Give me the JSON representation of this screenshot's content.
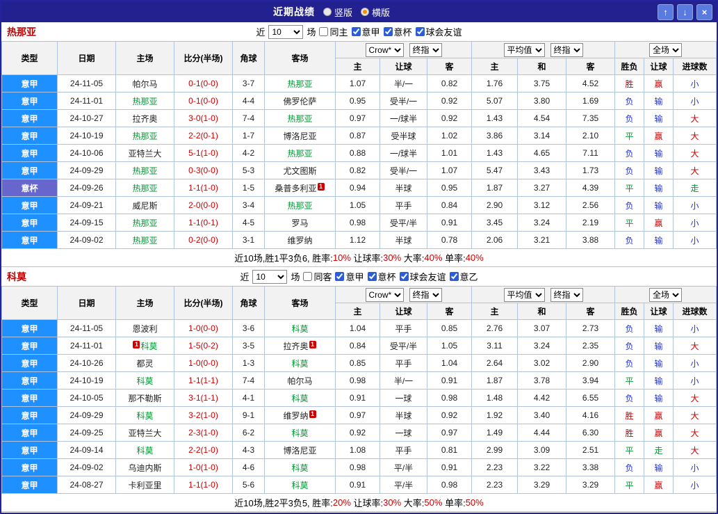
{
  "colors": {
    "win": "#cc0000",
    "draw": "#009933",
    "lose": "#2233cc",
    "score": "#cc0000",
    "self_team": "#009933",
    "badge_bg": "#d00000",
    "league_bg": "#1e90ff",
    "cup_bg": "#6666cc",
    "titlebar_bg": "#23218f",
    "grid_border": "#b0c4de"
  },
  "value_colors": {
    "胜": "win",
    "赢": "win",
    "大": "win",
    "平": "draw",
    "走": "draw",
    "负": "lose",
    "输": "lose",
    "小": "lose"
  },
  "type_bg_map": {
    "意甲": "league_bg",
    "意杯": "cup_bg"
  },
  "titlebar": {
    "title": "近期战绩",
    "layout_options": [
      {
        "label": "竖版",
        "selected": false
      },
      {
        "label": "横版",
        "selected": true
      }
    ],
    "buttons": {
      "up": "↑",
      "down": "↓",
      "close": "×"
    }
  },
  "table_header": {
    "type": "类型",
    "date": "日期",
    "home": "主场",
    "score": "比分(半场)",
    "corners": "角球",
    "away": "客场",
    "odds_group": {
      "select1": "Crow*",
      "select2": "终指",
      "cols": [
        "主",
        "让球",
        "客"
      ]
    },
    "avg_group": {
      "select1": "平均值",
      "select2": "终指",
      "cols": [
        "主",
        "和",
        "客"
      ]
    },
    "result_group": {
      "select1": "全场",
      "cols": [
        "胜负",
        "让球",
        "进球数"
      ]
    }
  },
  "sections": [
    {
      "team": "热那亚",
      "filter": {
        "near": "近",
        "count": "10",
        "games": "场",
        "same": {
          "label": "同主",
          "checked": false
        },
        "leagues": [
          {
            "label": "意甲",
            "checked": true
          },
          {
            "label": "意杯",
            "checked": true
          },
          {
            "label": "球会友谊",
            "checked": true
          }
        ]
      },
      "rows": [
        {
          "type": "意甲",
          "date": "24-11-05",
          "home": {
            "text": "帕尔马"
          },
          "score": "0-1(0-0)",
          "corners": "3-7",
          "away": {
            "text": "热那亚",
            "self": true
          },
          "odds": [
            "1.07",
            "半/一",
            "0.82"
          ],
          "avg": [
            "1.76",
            "3.75",
            "4.52"
          ],
          "result": "胜",
          "handicap": "赢",
          "goals": "小"
        },
        {
          "type": "意甲",
          "date": "24-11-01",
          "home": {
            "text": "热那亚",
            "self": true
          },
          "score": "0-1(0-0)",
          "corners": "4-4",
          "away": {
            "text": "佛罗伦萨"
          },
          "odds": [
            "0.95",
            "受半/一",
            "0.92"
          ],
          "avg": [
            "5.07",
            "3.80",
            "1.69"
          ],
          "result": "负",
          "handicap": "输",
          "goals": "小"
        },
        {
          "type": "意甲",
          "date": "24-10-27",
          "home": {
            "text": "拉齐奥"
          },
          "score": "3-0(1-0)",
          "corners": "7-4",
          "away": {
            "text": "热那亚",
            "self": true
          },
          "odds": [
            "0.97",
            "一/球半",
            "0.92"
          ],
          "avg": [
            "1.43",
            "4.54",
            "7.35"
          ],
          "result": "负",
          "handicap": "输",
          "goals": "大"
        },
        {
          "type": "意甲",
          "date": "24-10-19",
          "home": {
            "text": "热那亚",
            "self": true
          },
          "score": "2-2(0-1)",
          "corners": "1-7",
          "away": {
            "text": "博洛尼亚"
          },
          "odds": [
            "0.87",
            "受半球",
            "1.02"
          ],
          "avg": [
            "3.86",
            "3.14",
            "2.10"
          ],
          "result": "平",
          "handicap": "赢",
          "goals": "大"
        },
        {
          "type": "意甲",
          "date": "24-10-06",
          "home": {
            "text": "亚特兰大"
          },
          "score": "5-1(1-0)",
          "corners": "4-2",
          "away": {
            "text": "热那亚",
            "self": true
          },
          "odds": [
            "0.88",
            "一/球半",
            "1.01"
          ],
          "avg": [
            "1.43",
            "4.65",
            "7.11"
          ],
          "result": "负",
          "handicap": "输",
          "goals": "大"
        },
        {
          "type": "意甲",
          "date": "24-09-29",
          "home": {
            "text": "热那亚",
            "self": true
          },
          "score": "0-3(0-0)",
          "corners": "5-3",
          "away": {
            "text": "尤文图斯"
          },
          "odds": [
            "0.82",
            "受半/一",
            "1.07"
          ],
          "avg": [
            "5.47",
            "3.43",
            "1.73"
          ],
          "result": "负",
          "handicap": "输",
          "goals": "大"
        },
        {
          "type": "意杯",
          "date": "24-09-26",
          "home": {
            "text": "热那亚",
            "self": true
          },
          "score": "1-1(1-0)",
          "corners": "1-5",
          "away": {
            "text": "桑普多利亚",
            "badge_after": "1"
          },
          "odds": [
            "0.94",
            "半球",
            "0.95"
          ],
          "avg": [
            "1.87",
            "3.27",
            "4.39"
          ],
          "result": "平",
          "handicap": "输",
          "goals": "走"
        },
        {
          "type": "意甲",
          "date": "24-09-21",
          "home": {
            "text": "威尼斯"
          },
          "score": "2-0(0-0)",
          "corners": "3-4",
          "away": {
            "text": "热那亚",
            "self": true
          },
          "odds": [
            "1.05",
            "平手",
            "0.84"
          ],
          "avg": [
            "2.90",
            "3.12",
            "2.56"
          ],
          "result": "负",
          "handicap": "输",
          "goals": "小"
        },
        {
          "type": "意甲",
          "date": "24-09-15",
          "home": {
            "text": "热那亚",
            "self": true
          },
          "score": "1-1(0-1)",
          "corners": "4-5",
          "away": {
            "text": "罗马"
          },
          "odds": [
            "0.98",
            "受平/半",
            "0.91"
          ],
          "avg": [
            "3.45",
            "3.24",
            "2.19"
          ],
          "result": "平",
          "handicap": "赢",
          "goals": "小"
        },
        {
          "type": "意甲",
          "date": "24-09-02",
          "home": {
            "text": "热那亚",
            "self": true
          },
          "score": "0-2(0-0)",
          "corners": "3-1",
          "away": {
            "text": "维罗纳"
          },
          "odds": [
            "1.12",
            "半球",
            "0.78"
          ],
          "avg": [
            "2.06",
            "3.21",
            "3.88"
          ],
          "result": "负",
          "handicap": "输",
          "goals": "小"
        }
      ],
      "summary": [
        {
          "text": "近10场,胜1平3负6, 胜率:",
          "red": false
        },
        {
          "text": "10%",
          "red": true
        },
        {
          "text": " 让球率:",
          "red": false
        },
        {
          "text": "30%",
          "red": true
        },
        {
          "text": " 大率:",
          "red": false
        },
        {
          "text": "40%",
          "red": true
        },
        {
          "text": " 单率:",
          "red": false
        },
        {
          "text": "40%",
          "red": true
        }
      ]
    },
    {
      "team": "科莫",
      "filter": {
        "near": "近",
        "count": "10",
        "games": "场",
        "same": {
          "label": "同客",
          "checked": false
        },
        "leagues": [
          {
            "label": "意甲",
            "checked": true
          },
          {
            "label": "意杯",
            "checked": true
          },
          {
            "label": "球会友谊",
            "checked": true
          },
          {
            "label": "意乙",
            "checked": true
          }
        ]
      },
      "rows": [
        {
          "type": "意甲",
          "date": "24-11-05",
          "home": {
            "text": "恩波利"
          },
          "score": "1-0(0-0)",
          "corners": "3-6",
          "away": {
            "text": "科莫",
            "self": true
          },
          "odds": [
            "1.04",
            "平手",
            "0.85"
          ],
          "avg": [
            "2.76",
            "3.07",
            "2.73"
          ],
          "result": "负",
          "handicap": "输",
          "goals": "小"
        },
        {
          "type": "意甲",
          "date": "24-11-01",
          "home": {
            "text": "科莫",
            "self": true,
            "badge_before": "1"
          },
          "score": "1-5(0-2)",
          "corners": "3-5",
          "away": {
            "text": "拉齐奥",
            "badge_after": "1"
          },
          "odds": [
            "0.84",
            "受平/半",
            "1.05"
          ],
          "avg": [
            "3.11",
            "3.24",
            "2.35"
          ],
          "result": "负",
          "handicap": "输",
          "goals": "大"
        },
        {
          "type": "意甲",
          "date": "24-10-26",
          "home": {
            "text": "都灵"
          },
          "score": "1-0(0-0)",
          "corners": "1-3",
          "away": {
            "text": "科莫",
            "self": true
          },
          "odds": [
            "0.85",
            "平手",
            "1.04"
          ],
          "avg": [
            "2.64",
            "3.02",
            "2.90"
          ],
          "result": "负",
          "handicap": "输",
          "goals": "小"
        },
        {
          "type": "意甲",
          "date": "24-10-19",
          "home": {
            "text": "科莫",
            "self": true
          },
          "score": "1-1(1-1)",
          "corners": "7-4",
          "away": {
            "text": "帕尔马"
          },
          "odds": [
            "0.98",
            "半/一",
            "0.91"
          ],
          "avg": [
            "1.87",
            "3.78",
            "3.94"
          ],
          "result": "平",
          "handicap": "输",
          "goals": "小"
        },
        {
          "type": "意甲",
          "date": "24-10-05",
          "home": {
            "text": "那不勒斯"
          },
          "score": "3-1(1-1)",
          "corners": "4-1",
          "away": {
            "text": "科莫",
            "self": true
          },
          "odds": [
            "0.91",
            "一球",
            "0.98"
          ],
          "avg": [
            "1.48",
            "4.42",
            "6.55"
          ],
          "result": "负",
          "handicap": "输",
          "goals": "大"
        },
        {
          "type": "意甲",
          "date": "24-09-29",
          "home": {
            "text": "科莫",
            "self": true
          },
          "score": "3-2(1-0)",
          "corners": "9-1",
          "away": {
            "text": "维罗纳",
            "badge_after": "1"
          },
          "odds": [
            "0.97",
            "半球",
            "0.92"
          ],
          "avg": [
            "1.92",
            "3.40",
            "4.16"
          ],
          "result": "胜",
          "handicap": "赢",
          "goals": "大"
        },
        {
          "type": "意甲",
          "date": "24-09-25",
          "home": {
            "text": "亚特兰大"
          },
          "score": "2-3(1-0)",
          "corners": "6-2",
          "away": {
            "text": "科莫",
            "self": true
          },
          "odds": [
            "0.92",
            "一球",
            "0.97"
          ],
          "avg": [
            "1.49",
            "4.44",
            "6.30"
          ],
          "result": "胜",
          "handicap": "赢",
          "goals": "大"
        },
        {
          "type": "意甲",
          "date": "24-09-14",
          "home": {
            "text": "科莫",
            "self": true
          },
          "score": "2-2(1-0)",
          "corners": "4-3",
          "away": {
            "text": "博洛尼亚"
          },
          "odds": [
            "1.08",
            "平手",
            "0.81"
          ],
          "avg": [
            "2.99",
            "3.09",
            "2.51"
          ],
          "result": "平",
          "handicap": "走",
          "goals": "大"
        },
        {
          "type": "意甲",
          "date": "24-09-02",
          "home": {
            "text": "乌迪内斯"
          },
          "score": "1-0(1-0)",
          "corners": "4-6",
          "away": {
            "text": "科莫",
            "self": true
          },
          "odds": [
            "0.98",
            "平/半",
            "0.91"
          ],
          "avg": [
            "2.23",
            "3.22",
            "3.38"
          ],
          "result": "负",
          "handicap": "输",
          "goals": "小"
        },
        {
          "type": "意甲",
          "date": "24-08-27",
          "home": {
            "text": "卡利亚里"
          },
          "score": "1-1(1-0)",
          "corners": "5-6",
          "away": {
            "text": "科莫",
            "self": true
          },
          "odds": [
            "0.91",
            "平/半",
            "0.98"
          ],
          "avg": [
            "2.23",
            "3.29",
            "3.29"
          ],
          "result": "平",
          "handicap": "赢",
          "goals": "小"
        }
      ],
      "summary": [
        {
          "text": "近10场,胜2平3负5, 胜率:",
          "red": false
        },
        {
          "text": "20%",
          "red": true
        },
        {
          "text": " 让球率:",
          "red": false
        },
        {
          "text": "30%",
          "red": true
        },
        {
          "text": " 大率:",
          "red": false
        },
        {
          "text": "50%",
          "red": true
        },
        {
          "text": " 单率:",
          "red": false
        },
        {
          "text": "50%",
          "red": true
        }
      ]
    }
  ]
}
